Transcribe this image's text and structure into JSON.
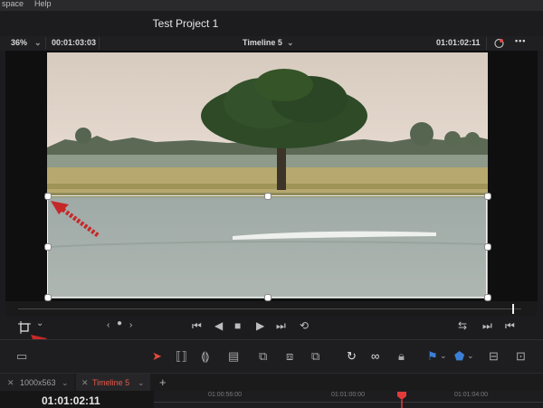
{
  "menu": {
    "items": [
      "space",
      "Help"
    ]
  },
  "project": {
    "title": "Test Project 1"
  },
  "viewer": {
    "zoom": "36%",
    "source_timecode": "00:01:03:03",
    "timeline_name": "Timeline 5",
    "record_timecode": "01:01:02:11"
  },
  "tabs": [
    {
      "label": "1000x563"
    },
    {
      "label": "Timeline 5"
    }
  ],
  "timeline": {
    "current_timecode": "01:01:02:11",
    "ruler_labels": [
      "01:00:56:00",
      "01:01:00:00",
      "01:01:04:00"
    ]
  },
  "icons": {
    "transform": "transform-icon",
    "first_frame": "skip-back-icon",
    "prev": "step-back-icon",
    "stop": "stop-icon",
    "play": "play-icon",
    "last_frame": "skip-forward-icon",
    "loop": "loop-icon"
  },
  "colors": {
    "playhead": "#e23b3b",
    "tab_active_text": "#e55a4a",
    "selection": "#3c7fd6"
  }
}
